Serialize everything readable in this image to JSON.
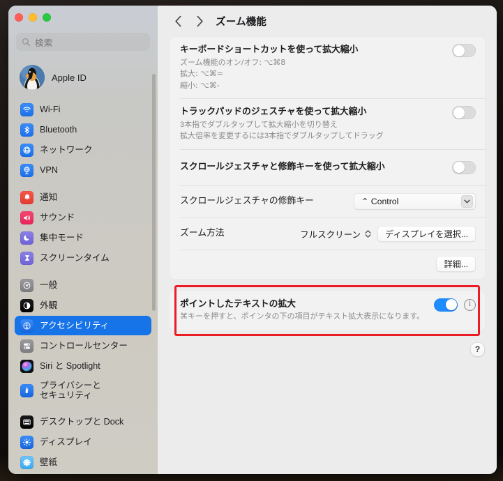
{
  "window": {
    "traffic_lights": [
      "close",
      "minimize",
      "zoom"
    ],
    "colors": {
      "accent": "#1773e8",
      "toggle_on": "#1e8bff",
      "highlight": "#ec1c24"
    }
  },
  "sidebar": {
    "search": {
      "placeholder": "検索",
      "icon": "search-icon"
    },
    "account": {
      "name": "Apple ID",
      "avatar": "penguin-avatar"
    },
    "groups": [
      {
        "items": [
          {
            "label": "Wi-Fi",
            "icon": "wifi-icon",
            "selected": false
          },
          {
            "label": "Bluetooth",
            "icon": "bluetooth-icon",
            "selected": false
          },
          {
            "label": "ネットワーク",
            "icon": "network-globe-icon",
            "selected": false
          },
          {
            "label": "VPN",
            "icon": "vpn-icon",
            "selected": false
          }
        ]
      },
      {
        "items": [
          {
            "label": "通知",
            "icon": "notifications-bell-icon",
            "selected": false
          },
          {
            "label": "サウンド",
            "icon": "sound-speaker-icon",
            "selected": false
          },
          {
            "label": "集中モード",
            "icon": "focus-moon-icon",
            "selected": false
          },
          {
            "label": "スクリーンタイム",
            "icon": "screen-time-hourglass-icon",
            "selected": false
          }
        ]
      },
      {
        "items": [
          {
            "label": "一般",
            "icon": "general-gear-icon",
            "selected": false
          },
          {
            "label": "外観",
            "icon": "appearance-contrast-icon",
            "selected": false
          },
          {
            "label": "アクセシビリティ",
            "icon": "accessibility-icon",
            "selected": true
          },
          {
            "label": "コントロールセンター",
            "icon": "control-center-icon",
            "selected": false
          },
          {
            "label": "Siri と Spotlight",
            "icon": "siri-icon",
            "selected": false
          },
          {
            "label": "プライバシーと",
            "label2": "セキュリティ",
            "icon": "privacy-hand-icon",
            "selected": false
          }
        ]
      },
      {
        "items": [
          {
            "label": "デスクトップと Dock",
            "icon": "desktop-dock-icon",
            "selected": false
          },
          {
            "label": "ディスプレイ",
            "icon": "display-brightness-icon",
            "selected": false
          },
          {
            "label": "壁紙",
            "icon": "wallpaper-icon",
            "selected": false
          }
        ]
      }
    ]
  },
  "header": {
    "back_icon": "chevron-left-icon",
    "forward_icon": "chevron-right-icon",
    "title": "ズーム機能"
  },
  "main": {
    "card1": {
      "keyboard_shortcut": {
        "title": "キーボードショートカットを使って拡大縮小",
        "subtitle": "ズーム機能のオン/オフ: ⌥⌘8\n拡大: ⌥⌘=\n縮小: ⌥⌘-",
        "toggle": "off"
      },
      "trackpad_gesture": {
        "title": "トラックパッドのジェスチャを使って拡大縮小",
        "subtitle": "3本指でダブルタップして拡大縮小を切り替え\n拡大倍率を変更するには3本指でダブルタップしてドラッグ",
        "toggle": "off"
      },
      "scroll_gesture": {
        "title": "スクロールジェスチャと修飾キーを使って拡大縮小",
        "toggle": "off"
      },
      "modifier_key": {
        "title": "スクロールジェスチャの修飾キー",
        "value": "⌃ Control",
        "chevron_icon": "chevron-down-icon"
      },
      "zoom_style": {
        "title": "ズーム方法",
        "value": "フルスクリーン",
        "stepper_icon": "chevron-updown-icon",
        "button_label": "ディスプレイを選択..."
      },
      "advanced_button": "詳細..."
    },
    "card2": {
      "hover_text": {
        "title": "ポイントしたテキストの拡大",
        "subtitle": "⌘キーを押すと、ポインタの下の項目がテキスト拡大表示になります。",
        "toggle": "on",
        "info_icon": "info-circle-icon"
      },
      "highlighted": true
    },
    "help_button": "?"
  }
}
